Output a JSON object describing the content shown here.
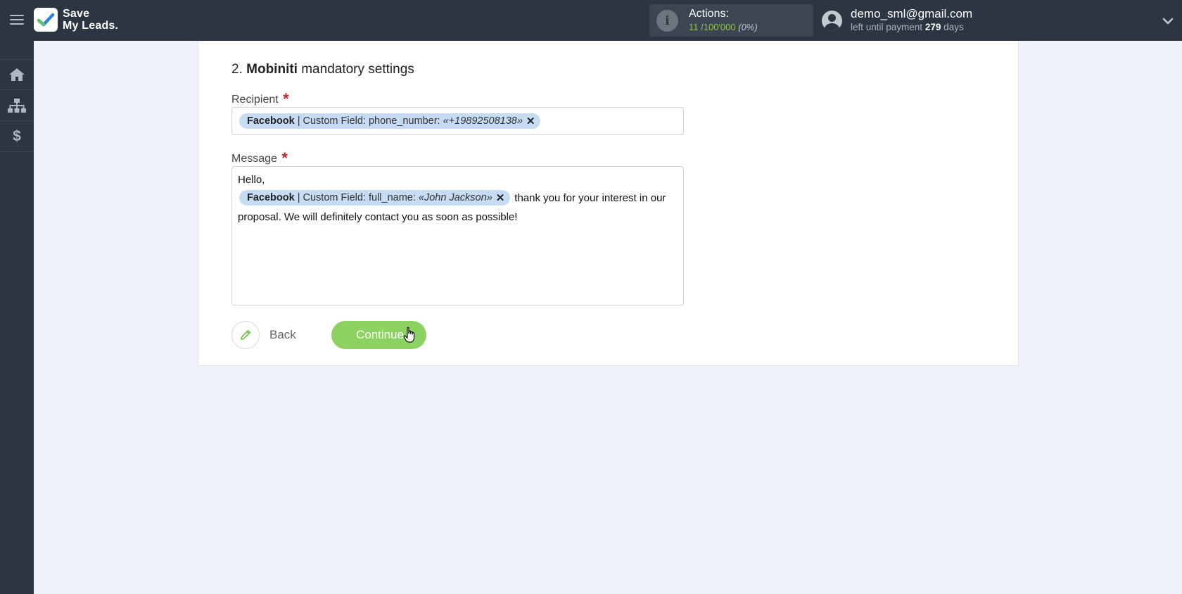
{
  "header": {
    "logo_line1": "Save",
    "logo_line2": "My Leads.",
    "actions_label": "Actions:",
    "actions_used": "11",
    "actions_total": "/100'000",
    "actions_percent": "(0%)",
    "user_email": "demo_sml@gmail.com",
    "payment_prefix": "left until payment",
    "payment_days": "279",
    "payment_suffix": "days"
  },
  "sidebar": {
    "items": [
      {
        "icon": "home-icon"
      },
      {
        "icon": "sitemap-icon"
      },
      {
        "icon": "dollar-icon",
        "glyph": "$"
      }
    ]
  },
  "form": {
    "section_number": "2.",
    "section_name": "Mobiniti",
    "section_suffix": "mandatory settings",
    "recipient_label": "Recipient",
    "required_mark": "*",
    "recipient_tag": {
      "source": "Facebook",
      "field": " | Custom Field: phone_number: ",
      "value": "«+19892508138»",
      "remove": "✕"
    },
    "message_label": "Message",
    "message_line1": "Hello,",
    "message_tag": {
      "source": "Facebook",
      "field": " | Custom Field: full_name: ",
      "value": "«John Jackson»",
      "remove": "✕"
    },
    "message_after_tag": "thank you for your interest in our",
    "message_line3": "proposal. We will definitely contact you as soon as possible!",
    "back_label": "Back",
    "continue_label": "Continue"
  },
  "colors": {
    "topbar": "#2c3541",
    "accent_green": "#8bd260",
    "tag_bg": "#c6dbf4",
    "required_red": "#c0272d",
    "youtube_red": "#d62e2a"
  }
}
